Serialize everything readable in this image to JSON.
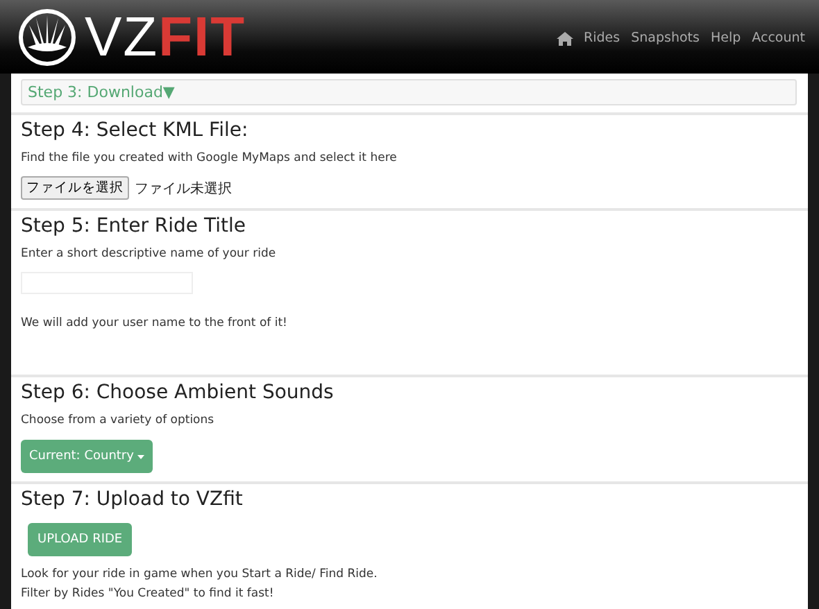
{
  "header": {
    "logo": {
      "part_1": "VZ",
      "part_2": "FIT"
    },
    "nav": [
      {
        "kind": "icon"
      },
      {
        "kind": "link",
        "label": "Rides"
      },
      {
        "kind": "link",
        "label": "Snapshots"
      },
      {
        "kind": "link",
        "label": "Help"
      },
      {
        "kind": "link",
        "label": "Account"
      }
    ]
  },
  "collapsed_step": {
    "title": "Step 3: Download",
    "arrow": "▼",
    "expanded": false
  },
  "steps": [
    {
      "kind": "file",
      "title": "Step 4: Select KML File:",
      "text": "Find the file you created with Google MyMaps and select it here",
      "button": "ファイルを選択",
      "status": "ファイル未選択"
    },
    {
      "kind": "input",
      "title": "Step 5: Enter Ride Title",
      "text": "Enter a short descriptive name of your ride",
      "note": "We will add your user name to the front of it!"
    },
    {
      "kind": "dropdown",
      "title": "Step 6: Choose Ambient Sounds",
      "text": "Choose from a variety of options",
      "button": "Current: Country"
    },
    {
      "kind": "upload",
      "title": "Step 7: Upload to VZfit",
      "button": "UPLOAD RIDE",
      "lines": [
        "Look for your ride in game when you Start a Ride/ Find Ride.",
        "Filter by Rides \"You Created\" to find it fast!"
      ]
    }
  ]
}
